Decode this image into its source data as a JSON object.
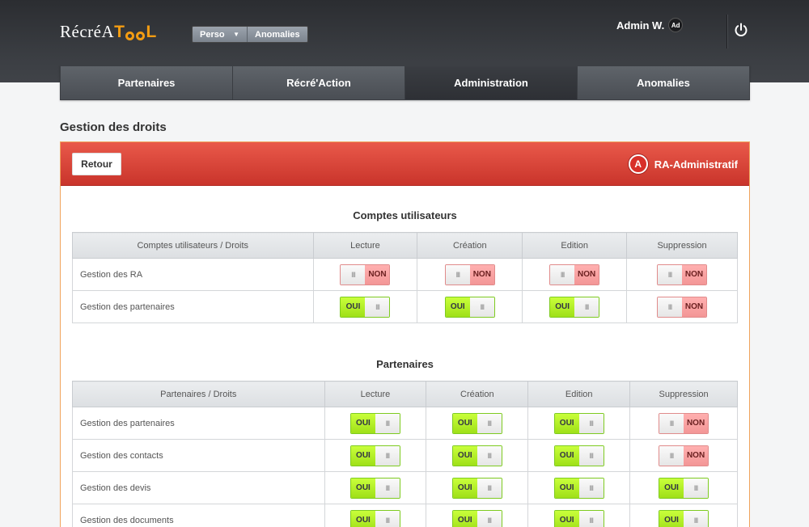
{
  "header": {
    "logo_text": "RécréA",
    "logo_accent": "T",
    "logo_accent2": "L",
    "dropdown_label": "Perso",
    "anomalies_label": "Anomalies",
    "user_name": "Admin W.",
    "avatar_initials": "Ad",
    "icons": {
      "power": "power-icon",
      "caret": "chevron-down-icon"
    }
  },
  "nav": {
    "tabs": [
      {
        "label": "Partenaires",
        "active": false
      },
      {
        "label": "Récré'Action",
        "active": false
      },
      {
        "label": "Administration",
        "active": true
      },
      {
        "label": "Anomalies",
        "active": false
      }
    ]
  },
  "page": {
    "title": "Gestion des droits"
  },
  "panel": {
    "back_label": "Retour",
    "role_badge": "A",
    "role_name": "RA-Administratif",
    "accent_color": "#d9392e"
  },
  "toggle_labels": {
    "on": "OUI",
    "off": "NON",
    "knob": "III"
  },
  "sections": [
    {
      "title": "Comptes utilisateurs",
      "headers": [
        "Comptes utilisateurs / Droits",
        "Lecture",
        "Création",
        "Edition",
        "Suppression"
      ],
      "rows": [
        {
          "label": "Gestion des RA",
          "values": [
            false,
            false,
            false,
            false
          ]
        },
        {
          "label": "Gestion des partenaires",
          "values": [
            true,
            true,
            true,
            false
          ]
        }
      ]
    },
    {
      "title": "Partenaires",
      "headers": [
        "Partenaires / Droits",
        "Lecture",
        "Création",
        "Edition",
        "Suppression"
      ],
      "rows": [
        {
          "label": "Gestion des partenaires",
          "values": [
            true,
            true,
            true,
            false
          ]
        },
        {
          "label": "Gestion des contacts",
          "values": [
            true,
            true,
            true,
            false
          ]
        },
        {
          "label": "Gestion des devis",
          "values": [
            true,
            true,
            true,
            true
          ]
        },
        {
          "label": "Gestion des documents",
          "values": [
            true,
            true,
            true,
            true
          ]
        }
      ]
    }
  ]
}
